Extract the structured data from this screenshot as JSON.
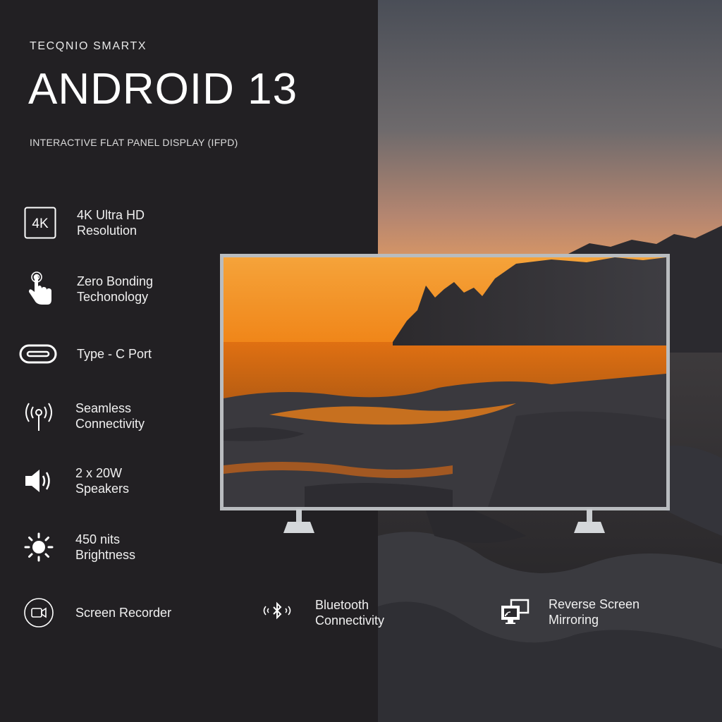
{
  "brand": "TECQNIO SMARTX",
  "headline": "ANDROID 13",
  "subtitle": "INTERACTIVE FLAT PANEL DISPLAY (IFPD)",
  "icon_4k_text": "4K",
  "features": [
    {
      "label": "4K Ultra HD\nResolution",
      "icon": "4k-badge-icon"
    },
    {
      "label": "Zero Bonding\nTechonology",
      "icon": "touch-hand-icon"
    },
    {
      "label": "Type - C Port",
      "icon": "usb-c-port-icon"
    },
    {
      "label": "Seamless\nConnectivity",
      "icon": "wireless-antenna-icon"
    },
    {
      "label": "2 x 20W\nSpeakers",
      "icon": "speaker-icon"
    },
    {
      "label": "450 nits\nBrightness",
      "icon": "sun-brightness-icon"
    },
    {
      "label": "Screen Recorder",
      "icon": "video-camera-icon"
    }
  ],
  "bottom_features": [
    {
      "label": "Bluetooth\nConnectivity",
      "icon": "bluetooth-icon"
    },
    {
      "label": "Reverse Screen\nMirroring",
      "icon": "screen-mirroring-icon"
    }
  ],
  "colors": {
    "panel_background": "#222023",
    "sky_top": "#4a4e57",
    "sky_glow": "#e89a5e",
    "screen_sunset": "#f08a1a",
    "tv_frame": "#b9bcbf"
  }
}
